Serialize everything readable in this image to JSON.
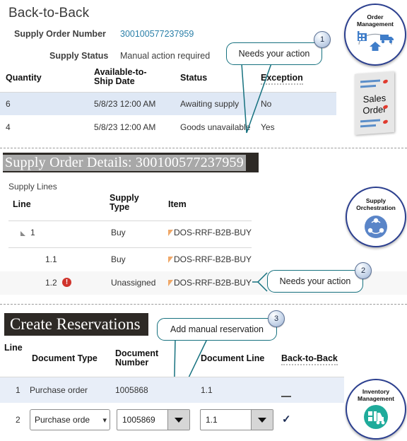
{
  "section1": {
    "title": "Back-to-Back",
    "fields": [
      {
        "label": "Supply Order Number",
        "value": "300100577237959",
        "is_link": true
      },
      {
        "label": "Supply Status",
        "value": "Manual action required",
        "is_link": false
      }
    ],
    "table": {
      "columns": [
        "Quantity",
        "Available-to-Ship Date",
        "Status",
        "Exception"
      ],
      "col_quantity": "Quantity",
      "col_ats_line1": "Available-to-",
      "col_ats_line2": "Ship Date",
      "col_status": "Status",
      "col_exception": "Exception",
      "rows": [
        {
          "quantity": "6",
          "date": "5/8/23 12:00 AM",
          "status": "Awaiting supply",
          "exception": "No"
        },
        {
          "quantity": "4",
          "date": "5/8/23 12:00 AM",
          "status": "Goods unavailable",
          "exception": "Yes"
        }
      ]
    },
    "callout": {
      "text": "Needs your action",
      "number": "1"
    }
  },
  "section2": {
    "banner": "Supply Order Details: 300100577237959",
    "subtitle": "Supply Lines",
    "table": {
      "col_line": "Line",
      "col_supply_type_line1": "Supply",
      "col_supply_type_line2": "Type",
      "col_item": "Item",
      "rows": [
        {
          "line": "1",
          "indent": 0,
          "expander": true,
          "error": false,
          "supply_type": "Buy",
          "item": "DOS-RRF-B2B-BUY"
        },
        {
          "line": "1.1",
          "indent": 1,
          "expander": false,
          "error": false,
          "supply_type": "Buy",
          "item": "DOS-RRF-B2B-BUY"
        },
        {
          "line": "1.2",
          "indent": 1,
          "expander": false,
          "error": true,
          "supply_type": "Unassigned",
          "item": "DOS-RRF-B2B-BUY"
        }
      ]
    },
    "callout": {
      "text": "Needs your action",
      "number": "2"
    }
  },
  "section3": {
    "banner": "Create Reservations",
    "table": {
      "col_line": "Line",
      "col_doc_type": "Document Type",
      "col_doc_number_line1": "Document",
      "col_doc_number_line2": "Number",
      "col_doc_line": "Document Line",
      "col_b2b": "Back-to-Back",
      "rows": [
        {
          "line": "1",
          "editable": false,
          "doc_type": "Purchase order",
          "doc_number": "1005868",
          "doc_line": "1.1",
          "b2b": "dash"
        },
        {
          "line": "2",
          "editable": true,
          "doc_type": "Purchase orde",
          "doc_number": "1005869",
          "doc_line": "1.1",
          "b2b": "check"
        }
      ]
    },
    "callout": {
      "text": "Add manual reservation",
      "number": "3"
    }
  },
  "rail": {
    "order_management": {
      "line1": "Order",
      "line2": "Management",
      "icon": "factory-truck-home-icon"
    },
    "sales_order": {
      "line1": "Sales",
      "line2": "Order",
      "icon": "document-card-icon"
    },
    "supply_orchestration": {
      "line1": "Supply",
      "line2": "Orchestration",
      "icon": "orchestration-nodes-icon"
    },
    "inventory_management": {
      "line1": "Inventory",
      "line2": "Management",
      "icon": "forklift-icon"
    }
  },
  "colors": {
    "link": "#2a7fa8",
    "callout_border": "#16717f",
    "banner_bg": "#2e2a26",
    "row_highlight": "#dfe8f5",
    "error_red": "#d0342c",
    "pill_border": "#2b3f8f",
    "orchestration_blue": "#5a85c8",
    "inventory_teal": "#1fab9b"
  }
}
